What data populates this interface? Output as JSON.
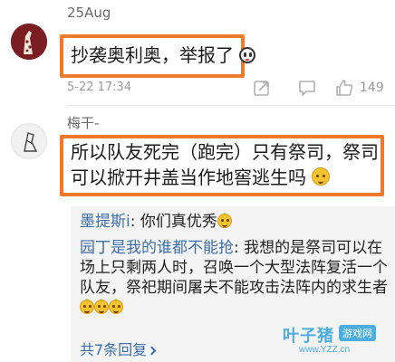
{
  "comments": [
    {
      "username": "25Aug",
      "text": "抄袭奥利奥，举报了",
      "emoji": "ghost-emoji",
      "time": "5-22 17:34",
      "like_count": "149"
    },
    {
      "username": "梅干-",
      "text": "所以队友死完（跑完）只有祭司，祭司可以掀开井盖当作地窖逃生吗",
      "emoji": "cat-grin-emoji"
    }
  ],
  "replies": [
    {
      "name": "墨提斯i",
      "text": "你们真优秀",
      "emoji_count": 1
    },
    {
      "name": "园丁是我的谁都不能抢",
      "text": "我想的是祭司可以在场上只剩两人时，召唤一个大型法阵复活一个队友，祭祀期间屠夫不能攻击法阵内的求生者",
      "emoji_count": 3
    }
  ],
  "more_replies": "共7条回复",
  "watermark": {
    "main": "叶子猪",
    "tag": "游戏网",
    "url": "www.YZZ.cn"
  },
  "colors": {
    "highlight": "#f07a2c",
    "link": "#3f6ea8",
    "meta": "#9a9a9a"
  }
}
